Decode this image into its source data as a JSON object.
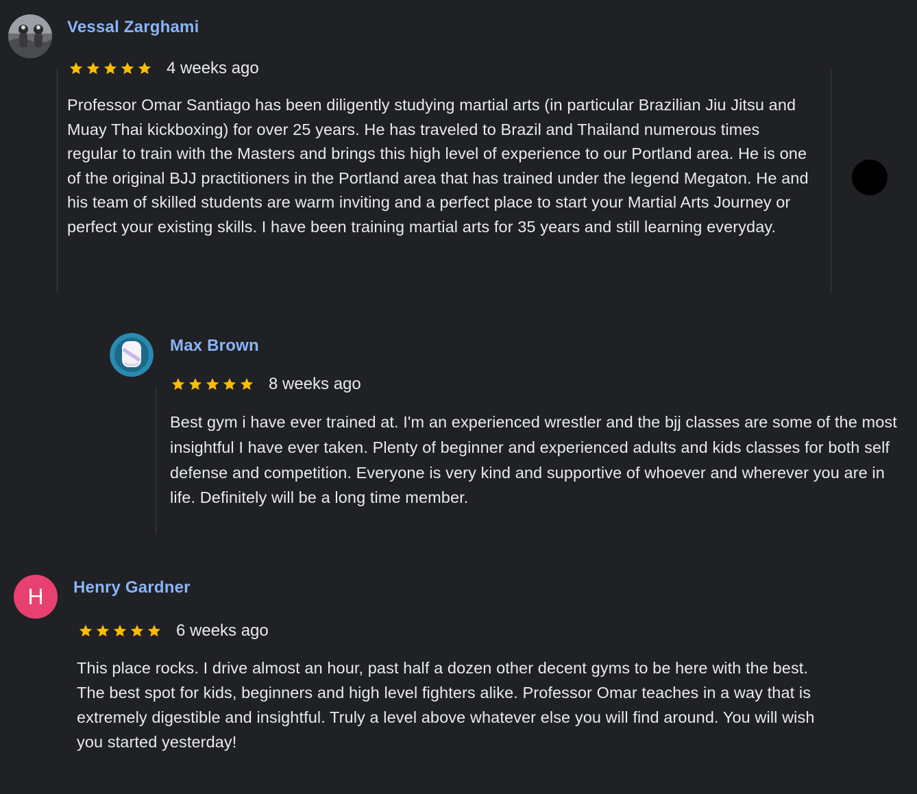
{
  "colors": {
    "background": "#202124",
    "name": "#8ab4f8",
    "text": "#e8eaed",
    "star": "#fbbc04",
    "divider": "#3c4043",
    "henry_avatar": "#e8416f"
  },
  "reviews": [
    {
      "author": "Vessal Zarghami",
      "avatar_icon": "photo-avatar-icon",
      "rating": 5,
      "time": "4 weeks ago",
      "text": "Professor Omar Santiago has been diligently studying martial arts (in particular Brazilian Jiu Jitsu and Muay Thai kickboxing) for over 25 years. He has traveled to Brazil and Thailand numerous times regular to train with the Masters and brings this high level of experience to our Portland area. He is one of the original BJJ practitioners in the Portland area that has trained under the legend Megaton. He and his team of skilled students are warm inviting and a perfect place to start your Martial Arts Journey or perfect your existing skills. I have been training martial arts for 35 years and still learning everyday."
    },
    {
      "author": "Max Brown",
      "avatar_icon": "photo-avatar-icon",
      "rating": 5,
      "time": "8 weeks ago",
      "text": "Best gym i have ever trained at. I'm an experienced wrestler and the bjj classes are some of the most insightful I have ever taken. Plenty of beginner and experienced adults and kids classes for both self defense and competition. Everyone is very kind and supportive of whoever and wherever you are in life. Definitely will be a long time member."
    },
    {
      "author": "Henry Gardner",
      "avatar_letter": "H",
      "rating": 5,
      "time": "6 weeks ago",
      "text": "This place rocks. I drive almost an hour, past half a dozen other decent gyms to be here with the best. The best spot for kids, beginners and high level fighters alike. Professor Omar teaches in a way that is extremely digestible and insightful. Truly a level above whatever else you will find around. You will wish you started yesterday!"
    }
  ]
}
